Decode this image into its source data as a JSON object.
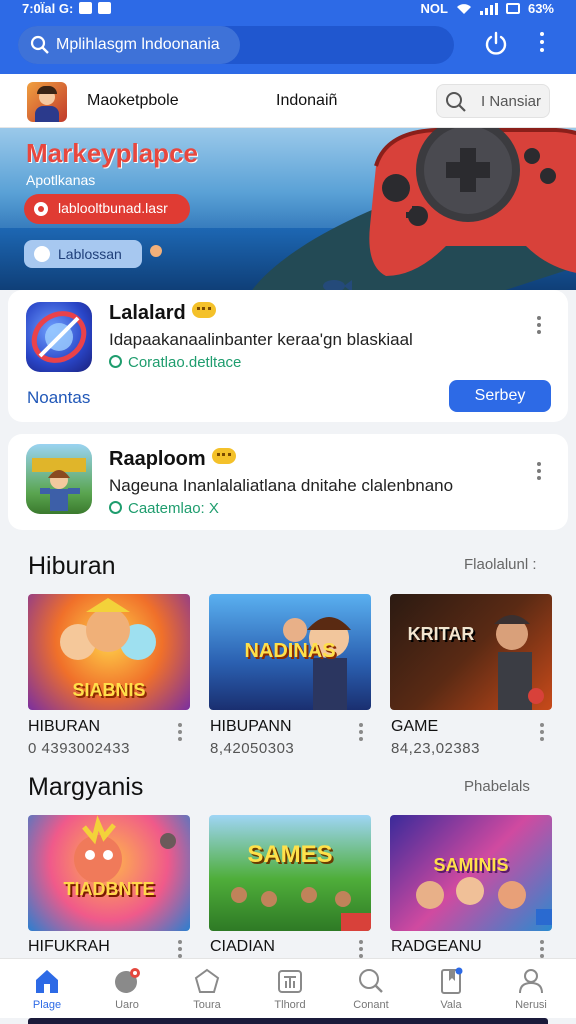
{
  "status_bar": {
    "time": "7:0Ïal G:",
    "right_text": "NOL",
    "battery": "63%"
  },
  "search": {
    "placeholder": "Mplihlasgm lndoonania"
  },
  "store": {
    "name": "Maoketpbole",
    "region": "Indonaiñ",
    "search_label": "I Nansiar"
  },
  "banner": {
    "title": "Markeyplapce",
    "subtitle": "Apotlkanas",
    "red_button": "lablooltbunad.lasr",
    "blue_button": "Lablossan"
  },
  "featured": [
    {
      "title": "Lalalard",
      "description": "Idapaakanaalinbanter keraa'gn blaskiaal",
      "meta": "Coratlao.detltace",
      "nearby": "Noantas",
      "action": "Serbey"
    },
    {
      "title": "Raaploom",
      "description": "Nageuna Inanlalaliatlana dnitahe clalenbnano",
      "meta": "Caatemlao: X"
    }
  ],
  "sections": [
    {
      "title": "Hiburan",
      "link": "Flaolalunl :",
      "items": [
        {
          "name": "HIBURAN",
          "number": "0 4393002433",
          "art_label": "SIABNIS"
        },
        {
          "name": "HIBUPANN",
          "number": "8,42050303",
          "art_label": "NADINAS"
        },
        {
          "name": "GAME",
          "number": "84,23,02383",
          "art_label": "KRITAR"
        }
      ]
    },
    {
      "title": "Margyanis",
      "link": "Phabelals",
      "items": [
        {
          "name": "HIFUKRAH",
          "art_label": "TIADBNTE"
        },
        {
          "name": "CIADIAN",
          "art_label": "SAMES"
        },
        {
          "name": "RADGEANU",
          "art_label": "SAMINIS"
        }
      ]
    }
  ],
  "bottom_nav": [
    {
      "label": "Plage",
      "icon": "home-icon"
    },
    {
      "label": "Uaro",
      "icon": "games-icon"
    },
    {
      "label": "Toura",
      "icon": "apps-icon"
    },
    {
      "label": "Tlhord",
      "icon": "tv-icon"
    },
    {
      "label": "Conant",
      "icon": "search-icon"
    },
    {
      "label": "Vala",
      "icon": "bookmark-icon"
    },
    {
      "label": "Nerusi",
      "icon": "profile-icon"
    }
  ],
  "colors": {
    "accent": "#2d6ae6",
    "banner_title": "#e8473e",
    "verified": "#1f9d6e"
  }
}
